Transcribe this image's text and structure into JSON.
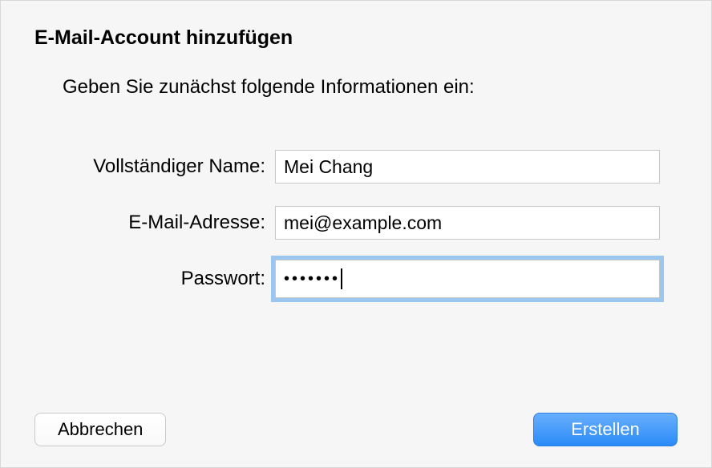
{
  "dialog": {
    "title": "E-Mail-Account hinzufügen",
    "subtitle": "Geben Sie zunächst folgende Informationen ein:"
  },
  "form": {
    "fullname_label": "Vollständiger Name:",
    "fullname_value": "Mei Chang",
    "email_label": "E-Mail-Adresse:",
    "email_value": "mei@example.com",
    "password_label": "Passwort:",
    "password_value": "•••••••"
  },
  "buttons": {
    "cancel": "Abbrechen",
    "create": "Erstellen"
  }
}
